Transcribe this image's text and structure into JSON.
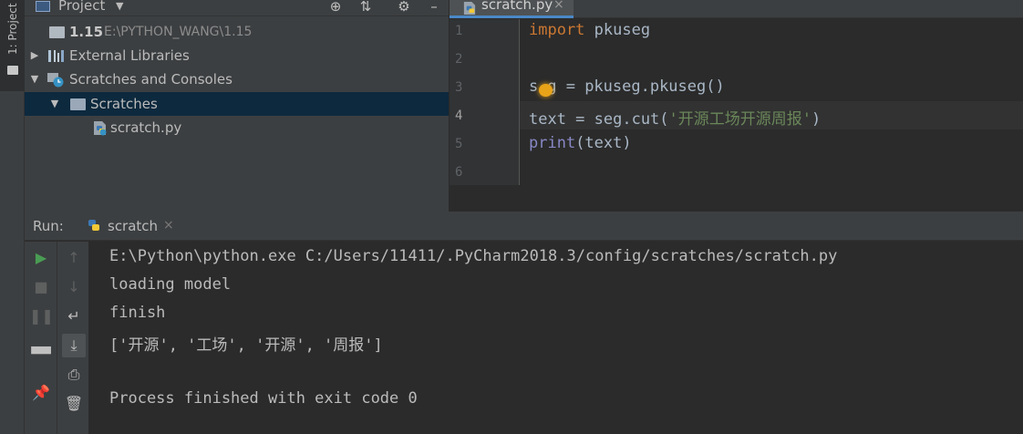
{
  "sidebar": {
    "project_tab_label": "1: Project"
  },
  "project": {
    "header_title": "Project",
    "tree": [
      {
        "label": "1.15",
        "path": "E:\\PYTHON_WANG\\1.15"
      },
      {
        "label": "External Libraries"
      },
      {
        "label": "Scratches and Consoles"
      },
      {
        "label": "Scratches"
      },
      {
        "label": "scratch.py"
      }
    ]
  },
  "editor": {
    "tab_label": "scratch.py",
    "line_numbers": [
      "1",
      "2",
      "3",
      "4",
      "5",
      "6"
    ],
    "lines": [
      {
        "kw": "import",
        "rest": " pkuseg"
      },
      {
        "text": ""
      },
      {
        "pre": "s",
        "post": "g = pkuseg.pkuseg()"
      },
      {
        "pre": "text = seg.cut(",
        "str": "'开源工场开源周报'",
        "post": ")"
      },
      {
        "builtin": "print",
        "post": "(text)"
      },
      {
        "text": ""
      }
    ]
  },
  "run": {
    "title": "Run:",
    "tab_label": "scratch",
    "console": [
      "E:\\Python\\python.exe C:/Users/11411/.PyCharm2018.3/config/scratches/scratch.py",
      "loading model",
      "finish",
      "['开源', '工场', '开源', '周报']",
      "",
      "Process finished with exit code 0"
    ]
  },
  "colors": {
    "keyword": "#cc7832",
    "string": "#6a8759",
    "builtin": "#8888c6",
    "selection": "#0d293e",
    "run_green": "#499c54"
  }
}
